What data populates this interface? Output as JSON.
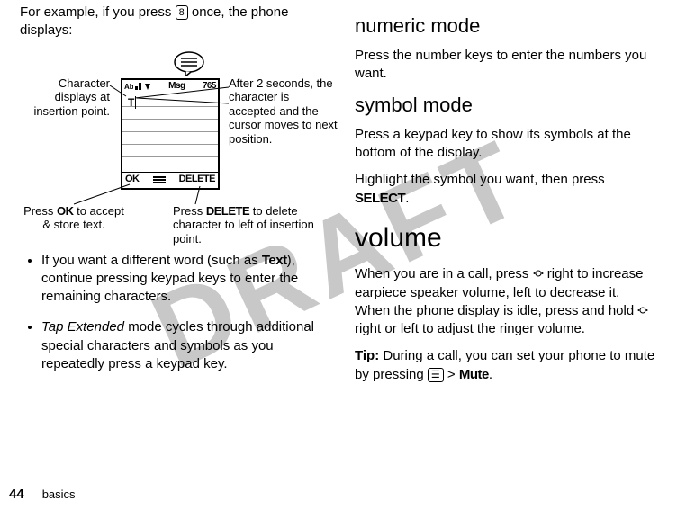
{
  "watermark": "DRAFT",
  "left": {
    "intro_pre": "For example, if you press ",
    "intro_key": "8",
    "intro_post": " once, the phone displays:",
    "diagram": {
      "status_msg": "Msg",
      "status_count": "765",
      "cursor_char": "T",
      "softkey_left": "OK",
      "softkey_right": "DELETE",
      "callout_top_left": "Character displays at insertion point.",
      "callout_top_right": "After 2 seconds, the character is accepted and the cursor moves to next position.",
      "callout_bottom_left_pre": "Press ",
      "callout_bottom_left_mid": "OK",
      "callout_bottom_left_post": " to accept & store text.",
      "callout_bottom_right_pre": "Press ",
      "callout_bottom_right_mid": "DELETE",
      "callout_bottom_right_post": " to delete character to left of insertion point."
    },
    "bullets": [
      {
        "pre": "If you want a different word (such as ",
        "strong": "Text",
        "post": "), continue pressing keypad keys to enter the remaining characters."
      },
      {
        "italic_lead": "Tap Extended",
        "rest": " mode cycles through additional special characters and symbols as you repeatedly press a keypad key."
      }
    ]
  },
  "right": {
    "h_numeric": "numeric mode",
    "p_numeric": "Press the number keys to enter the numbers you want.",
    "h_symbol": "symbol mode",
    "p_symbol1": "Press a keypad key to show its symbols at the bottom of the display.",
    "p_symbol2_pre": "Highlight the symbol you want, then press ",
    "p_symbol2_key": "SELECT",
    "p_symbol2_post": ".",
    "h_volume": "volume",
    "p_volume_a": "When you are in a call, press ",
    "p_volume_b": " right to increase earpiece speaker volume, left to decrease it. When the phone display is idle, press and hold ",
    "p_volume_c": " right or left to adjust the ringer volume.",
    "tip_label": "Tip:",
    "tip_pre": " During a call, you can set your phone to mute by pressing ",
    "tip_menu_key": "☰",
    "tip_gt": " > ",
    "tip_mute": "Mute",
    "tip_post": "."
  },
  "footer": {
    "page": "44",
    "section": "basics"
  }
}
